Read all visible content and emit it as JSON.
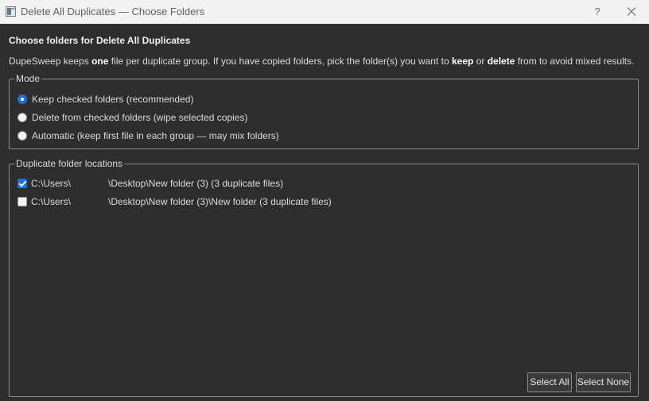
{
  "window": {
    "title": "Delete All Duplicates — Choose Folders",
    "help_label": "?",
    "close_icon": "close-icon",
    "app_icon": "window-app-icon"
  },
  "heading": "Choose folders for Delete All Duplicates",
  "description": {
    "part1": "DupeSweep keeps ",
    "bold1": "one",
    "part2": " file per duplicate group. If you have copied folders, pick the folder(s) you want to ",
    "bold2": "keep",
    "part3": " or ",
    "bold3": "delete",
    "part4": " from to avoid mixed results."
  },
  "mode": {
    "title": "Mode",
    "options": [
      {
        "label": "Keep checked folders (recommended)",
        "checked": true
      },
      {
        "label": "Delete from checked folders (wipe selected copies)",
        "checked": false
      },
      {
        "label": "Automatic (keep first file in each group — may mix folders)",
        "checked": false
      }
    ]
  },
  "locations": {
    "title": "Duplicate folder locations",
    "items": [
      {
        "prefix": "C:\\Users\\",
        "rest": "\\Desktop\\New folder (3)  (3 duplicate files)",
        "checked": true
      },
      {
        "prefix": "C:\\Users\\",
        "rest": "\\Desktop\\New folder (3)\\New folder  (3 duplicate files)",
        "checked": false
      }
    ],
    "select_all_label": "Select All",
    "select_none_label": "Select None"
  },
  "colors": {
    "background": "#2d2d2d",
    "titlebar": "#f3f3f3",
    "accent": "#1f6fd8"
  }
}
